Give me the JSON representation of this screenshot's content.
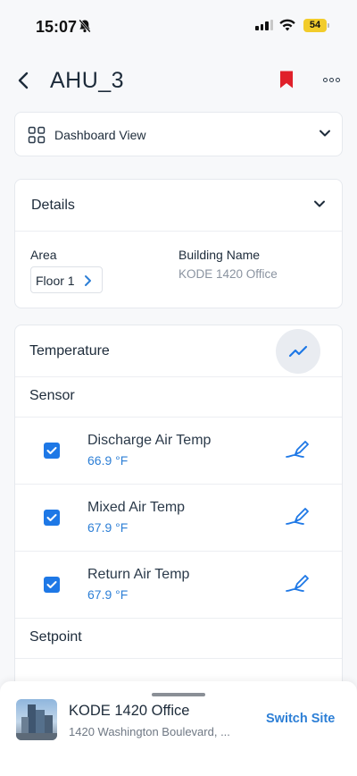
{
  "status_bar": {
    "time": "15:07",
    "battery": "54",
    "battery_color": "#f2cc2b"
  },
  "header": {
    "title": "AHU_3",
    "bookmark_color": "#e0202a",
    "icons": [
      "chevron-left-icon",
      "bookmark-icon",
      "more-icon"
    ]
  },
  "dashboard": {
    "label": "Dashboard View",
    "icon": "grid-icon"
  },
  "details": {
    "title": "Details",
    "area_label": "Area",
    "area_value": "Floor 1",
    "building_label": "Building Name",
    "building_value": "KODE 1420 Office"
  },
  "temperature": {
    "title": "Temperature",
    "sections": {
      "sensor": "Sensor",
      "setpoint": "Setpoint"
    },
    "sensors": [
      {
        "name": "Discharge Air Temp",
        "value": "66.9 °F",
        "checked": true
      },
      {
        "name": "Mixed Air Temp",
        "value": "67.9 °F",
        "checked": true
      },
      {
        "name": "Return Air Temp",
        "value": "67.9 °F",
        "checked": true
      }
    ],
    "accent_color": "#1e78e6"
  },
  "site_sheet": {
    "name": "KODE 1420 Office",
    "address": "1420 Washington Boulevard, ...",
    "switch_label": "Switch Site"
  }
}
